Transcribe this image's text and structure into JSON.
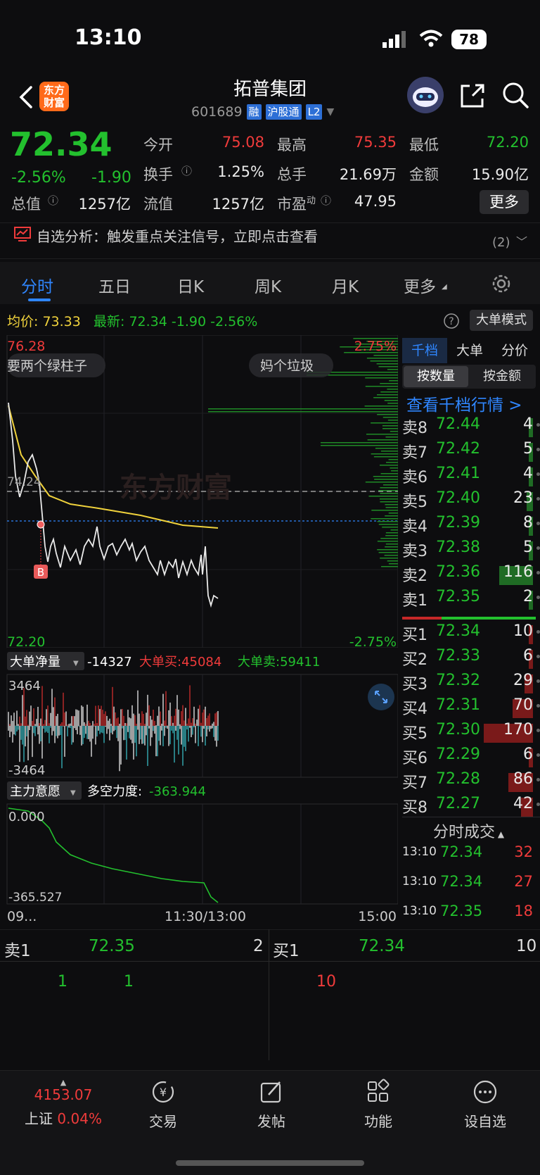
{
  "status": {
    "time": "13:10",
    "battery": "78"
  },
  "header": {
    "logo_line1": "东方",
    "logo_line2": "财富",
    "name": "拓普集团",
    "code": "601689",
    "tags": [
      "融",
      "沪股通",
      "L2"
    ]
  },
  "quote": {
    "price": "72.34",
    "change_pct": "-2.56%",
    "change_abs": "-1.90",
    "open_label": "今开",
    "open": "75.08",
    "high_label": "最高",
    "high": "75.35",
    "low_label": "最低",
    "low": "72.20",
    "turnover_label": "换手",
    "turnover": "1.25%",
    "volume_label": "总手",
    "volume": "21.69万",
    "amount_label": "金额",
    "amount": "15.90亿",
    "mcap_label": "总值",
    "mcap": "1257亿",
    "float_label": "流值",
    "float": "1257亿",
    "pe_label": "市盈",
    "pe_sup": "动",
    "pe": "47.95",
    "more": "更多"
  },
  "alert": {
    "text": "自选分析：触发重点关注信号，立即点击查看",
    "count": "(2)"
  },
  "tabs": [
    "分时",
    "五日",
    "日K",
    "周K",
    "月K",
    "更多"
  ],
  "avg_row": {
    "avg_label": "均价:",
    "avg": "73.33",
    "latest_label": "最新:",
    "latest": "72.34",
    "chg": "-1.90",
    "pct": "-2.56%",
    "big_mode": "大单模式"
  },
  "chart": {
    "y_high": "76.28",
    "y_high_pct": "2.75%",
    "y_low": "72.20",
    "y_low_pct": "-2.75%",
    "prev_close": "74.24",
    "comment1": "要两个绿柱子",
    "comment2": "妈个垃圾",
    "watermark": "东方财富",
    "buy_marker": "B",
    "net_label": "大单净量",
    "net_value": "-14327",
    "net_buy": "大单买:45084",
    "net_sell": "大单卖:59411",
    "net_max": "3464",
    "net_min": "-3464",
    "main_label": "主力意愿",
    "force_label": "多空力度:",
    "force_value": "-363.944",
    "main_max": "0.000",
    "main_min": "-365.527",
    "x_start": "09...",
    "x_mid": "11:30/13:00",
    "x_end": "15:00"
  },
  "orderbook": {
    "tabs": [
      "千档",
      "大单",
      "分价"
    ],
    "seg": [
      "按数量",
      "按金额"
    ],
    "link": "查看千档行情 >",
    "asks": [
      {
        "label": "卖8",
        "price": "72.44",
        "vol": "4"
      },
      {
        "label": "卖7",
        "price": "72.42",
        "vol": "5"
      },
      {
        "label": "卖6",
        "price": "72.41",
        "vol": "4"
      },
      {
        "label": "卖5",
        "price": "72.40",
        "vol": "23"
      },
      {
        "label": "卖4",
        "price": "72.39",
        "vol": "8"
      },
      {
        "label": "卖3",
        "price": "72.38",
        "vol": "5"
      },
      {
        "label": "卖2",
        "price": "72.36",
        "vol": "116"
      },
      {
        "label": "卖1",
        "price": "72.35",
        "vol": "2"
      }
    ],
    "bids": [
      {
        "label": "买1",
        "price": "72.34",
        "vol": "10"
      },
      {
        "label": "买2",
        "price": "72.33",
        "vol": "6"
      },
      {
        "label": "买3",
        "price": "72.32",
        "vol": "29"
      },
      {
        "label": "买4",
        "price": "72.31",
        "vol": "70"
      },
      {
        "label": "买5",
        "price": "72.30",
        "vol": "170"
      },
      {
        "label": "买6",
        "price": "72.29",
        "vol": "6"
      },
      {
        "label": "买7",
        "price": "72.28",
        "vol": "86"
      },
      {
        "label": "买8",
        "price": "72.27",
        "vol": "42"
      }
    ],
    "trades_title": "分时成交",
    "trades": [
      {
        "time": "13:10",
        "price": "72.34",
        "vol": "32"
      },
      {
        "time": "13:10",
        "price": "72.34",
        "vol": "27"
      },
      {
        "time": "13:10",
        "price": "72.35",
        "vol": "18"
      }
    ]
  },
  "bottom_quote": {
    "sell_label": "卖1",
    "sell_price": "72.35",
    "sell_vol": "2",
    "buy_label": "买1",
    "buy_price": "72.34",
    "buy_vol": "10",
    "sell_q1": "1",
    "sell_q2": "1",
    "buy_q1": "10"
  },
  "nav": {
    "index_value": "4153.07",
    "index_name": "上证",
    "index_pct": "0.04%",
    "items": [
      "交易",
      "发帖",
      "功能",
      "设自选"
    ]
  }
}
